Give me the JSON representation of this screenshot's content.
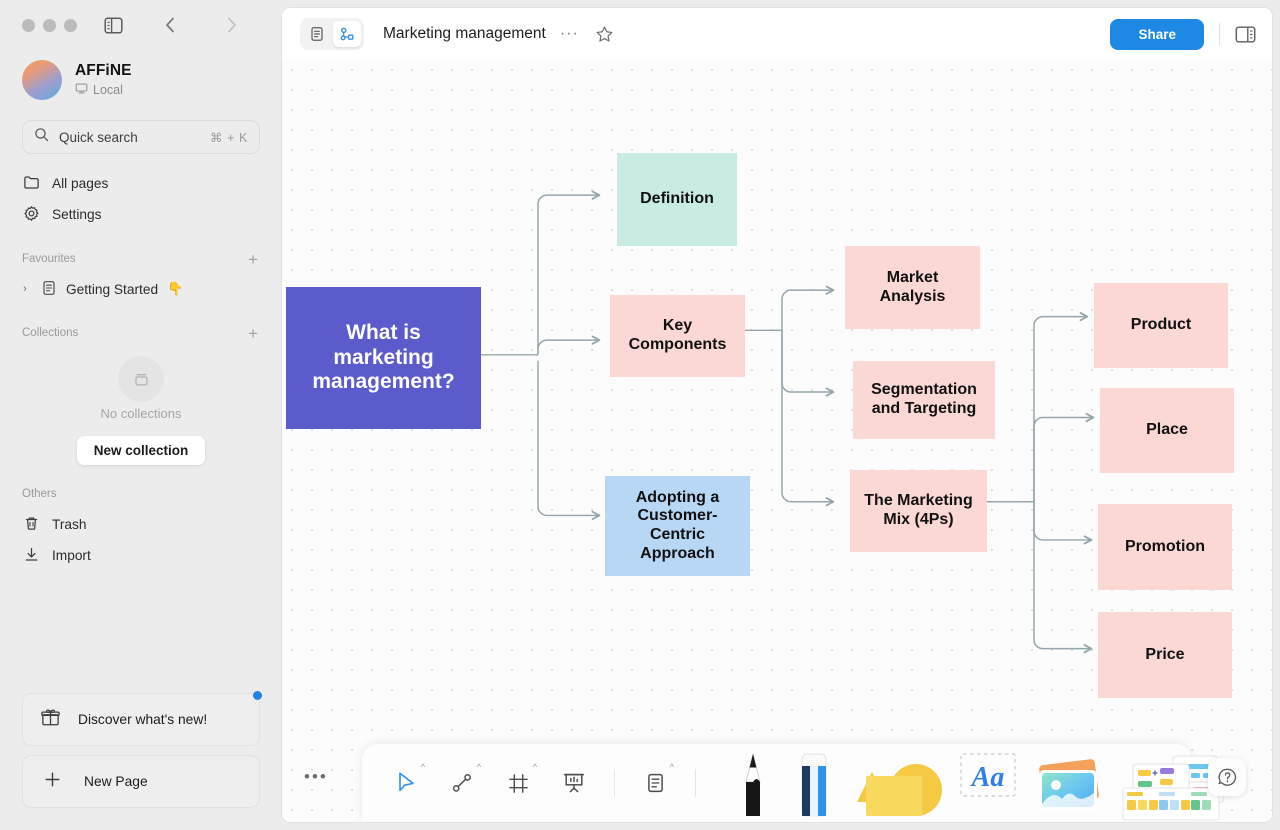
{
  "window": {
    "traffic_lights": [
      "close",
      "minimize",
      "maximize"
    ],
    "sidebar_toggle_icon": "sidebar-icon",
    "back_icon": "chevron-left-icon",
    "forward_icon": "chevron-right-icon"
  },
  "sidebar": {
    "workspace": {
      "name": "AFFiNE",
      "status": "Local",
      "status_icon": "monitor-icon"
    },
    "quick_search": {
      "label": "Quick search",
      "shortcut": "⌘ + K",
      "icon": "search-icon"
    },
    "nav": [
      {
        "label": "All pages",
        "icon": "folder-icon"
      },
      {
        "label": "Settings",
        "icon": "gear-icon"
      }
    ],
    "favourites": {
      "title": "Favourites",
      "add_icon": "plus-icon",
      "items": [
        {
          "label": "Getting Started",
          "emoji": "👇",
          "icon": "page-icon",
          "expand_icon": "chevron-right-icon"
        }
      ]
    },
    "collections": {
      "title": "Collections",
      "add_icon": "plus-icon",
      "empty_icon": "collection-icon",
      "empty_text": "No collections",
      "button_label": "New collection"
    },
    "others": {
      "title": "Others",
      "items": [
        {
          "label": "Trash",
          "icon": "trash-icon"
        },
        {
          "label": "Import",
          "icon": "import-icon"
        }
      ]
    },
    "bottom": {
      "discover_label": "Discover what's new!",
      "discover_icon": "gift-icon",
      "discover_badge_color": "#1e83e8",
      "new_page_label": "New Page",
      "new_page_icon": "plus-icon"
    }
  },
  "topbar": {
    "mode_page_icon": "page-mode-icon",
    "mode_edgeless_icon": "edgeless-mode-icon",
    "active_mode": "edgeless",
    "title": "Marketing management",
    "more_label": "···",
    "star_icon": "star-icon",
    "share_label": "Share",
    "share_color": "#1e88e5",
    "right_panel_icon": "right-sidebar-icon"
  },
  "canvas": {
    "more_menu_label": "•••",
    "help_icon": "question-bubble-icon",
    "colors": {
      "root": "#5b5bcb",
      "green": "#c8ebe3",
      "pink": "#fbd8d3",
      "blue": "#b8d7f5",
      "connector": "#93a6ab"
    },
    "mindmap": {
      "root": {
        "text": "What is marketing management?",
        "color": "#5b5bcb",
        "text_color": "#ffffff",
        "font_size": 21
      },
      "level1": [
        {
          "text": "Definition",
          "color": "#c8ebe3",
          "font_size": 16
        },
        {
          "text": "Key Components",
          "color": "#fbd8d3",
          "font_size": 16
        },
        {
          "text": "Adopting a Customer-Centric Approach",
          "color": "#b8d7f5",
          "font_size": 16
        }
      ],
      "level2": [
        {
          "text": "Market Analysis",
          "color": "#fbd8d3",
          "font_size": 16
        },
        {
          "text": "Segmentation and Targeting",
          "color": "#fbd8d3",
          "font_size": 16
        },
        {
          "text": "The Marketing Mix (4Ps)",
          "color": "#fbd8d3",
          "font_size": 16
        }
      ],
      "level3": [
        {
          "text": "Product",
          "color": "#fbd8d3",
          "font_size": 16
        },
        {
          "text": "Place",
          "color": "#fbd8d3",
          "font_size": 16
        },
        {
          "text": "Promotion",
          "color": "#fbd8d3",
          "font_size": 16
        },
        {
          "text": "Price",
          "color": "#fbd8d3",
          "font_size": 16
        }
      ]
    }
  },
  "toolbar": {
    "tools": [
      {
        "name": "select",
        "icon": "cursor-icon",
        "active": true,
        "caret": "^"
      },
      {
        "name": "connector",
        "icon": "connector-icon",
        "active": false,
        "caret": "^"
      },
      {
        "name": "frame",
        "icon": "frame-icon",
        "active": false,
        "caret": "^"
      },
      {
        "name": "present",
        "icon": "presentation-icon",
        "active": false,
        "caret": ""
      },
      {
        "name": "note",
        "icon": "note-icon",
        "active": false,
        "caret": "^"
      }
    ],
    "big_tools": [
      {
        "name": "pen",
        "icon": "pencil-icon"
      },
      {
        "name": "eraser",
        "icon": "eraser-icon"
      },
      {
        "name": "shape",
        "icon": "shapes-icon"
      },
      {
        "name": "text",
        "icon": "text-aa-icon",
        "label": "Aa"
      },
      {
        "name": "media",
        "icon": "image-icon"
      },
      {
        "name": "template",
        "icon": "template-icon"
      }
    ]
  }
}
